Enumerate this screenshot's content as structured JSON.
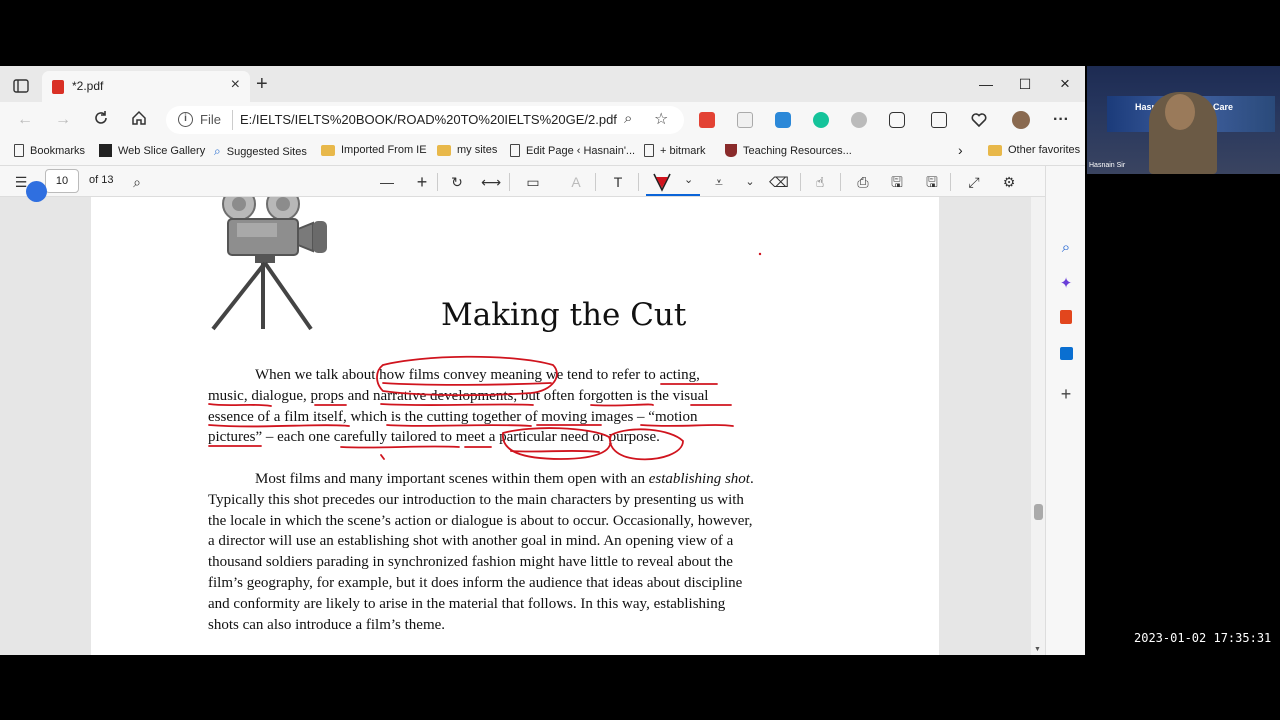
{
  "browser": {
    "tab_title": "*2.pdf",
    "url_scheme": "File",
    "url": "E:/IELTS/IELTS%20BOOK/ROAD%20TO%20IELTS%20GE/2.pdf"
  },
  "favorites": {
    "items": [
      {
        "label": "Bookmarks",
        "icon": "page-icon"
      },
      {
        "label": "Web Slice Gallery",
        "icon": "slice-icon"
      },
      {
        "label": "Suggested Sites",
        "icon": "search-icon"
      },
      {
        "label": "Imported From IE",
        "icon": "folder-icon"
      },
      {
        "label": "my sites",
        "icon": "folder-icon"
      },
      {
        "label": "Edit Page ‹ Hasnain'...",
        "icon": "page-icon"
      },
      {
        "label": "+ bitmark",
        "icon": "page-icon"
      },
      {
        "label": "Teaching Resources...",
        "icon": "crest-icon"
      }
    ],
    "other": "Other favorites"
  },
  "pdf_toolbar": {
    "page_number": "10",
    "page_total": "of 13"
  },
  "document": {
    "title": "Making the Cut",
    "para1_lines": [
      "When we talk about how films convey meaning we tend to refer to acting,",
      "music, dialogue, props and narrative developments, but often forgotten is the visual",
      "essence of a film itself, which is the cutting together of moving images – “motion",
      "pictures” – each one carefully tailored to meet a particular need or purpose."
    ],
    "para2_start": "Most films and many important scenes within them open with an ",
    "para2_italic": "establishing shot",
    "para2_rest": ". Typically this shot precedes our introduction to the main characters by presenting us with the locale in which the scene’s action or dialogue is about to occur. Occasionally, however, a director will use an establishing shot with another goal in mind. An opening view of a thousand soldiers parading in synchronized fashion might have little to reveal about the film’s geography, for example, but it does inform the audience that ideas about discipline and conformity are likely to arise in the material that follows. In this way, establishing shots can also introduce a film’s theme."
  },
  "webcam": {
    "name": "Hasnain Sir",
    "banner_left": "Hasn",
    "banner_right": "Care"
  },
  "timestamp": "2023-01-02  17:35:31",
  "colors": {
    "ink": "#d0141e",
    "accent": "#0a64d8"
  }
}
